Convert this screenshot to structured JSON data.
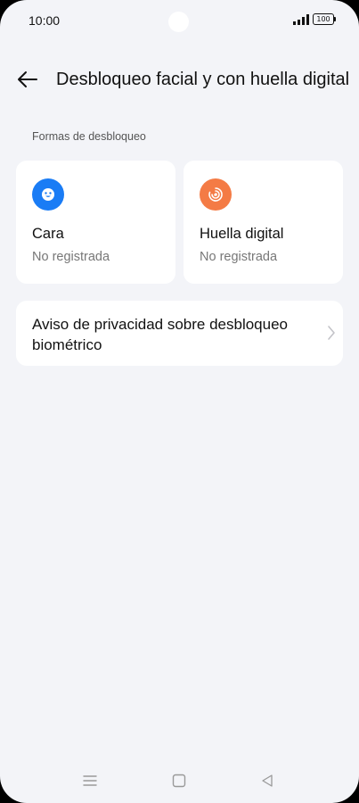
{
  "status_bar": {
    "time": "10:00",
    "battery": "100",
    "signal_icon": "signal-bars-icon",
    "battery_icon": "battery-icon"
  },
  "header": {
    "back_icon": "arrow-left-icon",
    "title": "Desbloqueo facial y con huella digital"
  },
  "section": {
    "label": "Formas de desbloqueo"
  },
  "methods": [
    {
      "title": "Cara",
      "status": "No registrada",
      "icon": "face-icon",
      "color": "#1a7cf5"
    },
    {
      "title": "Huella digital",
      "status": "No registrada",
      "icon": "fingerprint-icon",
      "color": "#f47b45"
    }
  ],
  "privacy": {
    "label": "Aviso de privacidad sobre desbloqueo biométrico",
    "icon": "chevron-right-icon"
  },
  "nav_bar": {
    "menu_icon": "menu-icon",
    "home_icon": "home-square-icon",
    "back_icon": "back-triangle-icon"
  },
  "colors": {
    "background": "#f3f4f8",
    "card": "#ffffff",
    "face_accent": "#1a7cf5",
    "fingerprint_accent": "#f47b45"
  }
}
